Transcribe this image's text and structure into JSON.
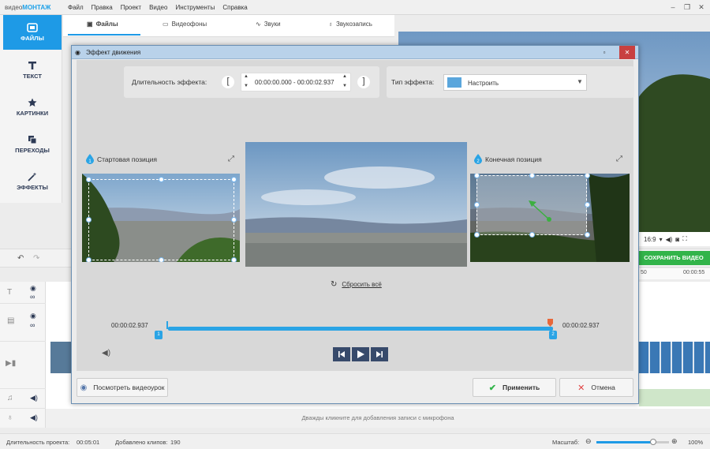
{
  "app": {
    "logo_prefix": "видео",
    "logo_brand": "МОНТАЖ",
    "menu": [
      "Файл",
      "Правка",
      "Проект",
      "Видео",
      "Инструменты",
      "Справка"
    ]
  },
  "leftnav": {
    "items": [
      {
        "label": "ФАЙЛЫ",
        "icon": "folder-icon"
      },
      {
        "label": "ТЕКСТ",
        "icon": "text-t-icon"
      },
      {
        "label": "КАРТИНКИ",
        "icon": "star-icon"
      },
      {
        "label": "ПЕРЕХОДЫ",
        "icon": "transition-icon"
      },
      {
        "label": "ЭФФЕКТЫ",
        "icon": "magic-wand-icon"
      }
    ]
  },
  "tabs": [
    "Файлы",
    "Видеофоны",
    "Звуки",
    "Звукозапись"
  ],
  "preview": {
    "ratio": "16:9",
    "save_label": "СОХРАНИТЬ ВИДЕО",
    "ruler_ticks": [
      "50",
      "00:00:55"
    ]
  },
  "timeline": {
    "mic_hint": "Дважды кликните для добавления записи с микрофона"
  },
  "status": {
    "duration_label": "Длительность проекта:",
    "duration_value": "00:05:01",
    "clips_label": "Добавлено клипов:",
    "clips_value": "190",
    "zoom_label": "Масштаб:",
    "zoom_value": "100%",
    "zoom_level": 0.78
  },
  "dialog": {
    "title": "Эффект движения",
    "duration_label": "Длительность эффекта:",
    "duration_range": "00:00:00.000 - 00:00:02.937",
    "type_label": "Тип эффекта:",
    "type_value": "Настроить",
    "start_num": "1",
    "start_label": "Стартовая позиция",
    "end_num": "2",
    "end_label": "Конечная позиция",
    "reset_label": "Сбросить всё",
    "time_left": "00:00:02.937",
    "time_right": "00:00:02.937",
    "marker1": "1",
    "marker2": "2",
    "watch_label": "Посмотреть видеоурок",
    "apply_label": "Применить",
    "cancel_label": "Отмена"
  },
  "colors": {
    "accent": "#1e9ae6",
    "save_green": "#32b44a",
    "apply_check": "#32b44a",
    "cancel_x": "#e04040",
    "marker": "#2aa4e5"
  }
}
